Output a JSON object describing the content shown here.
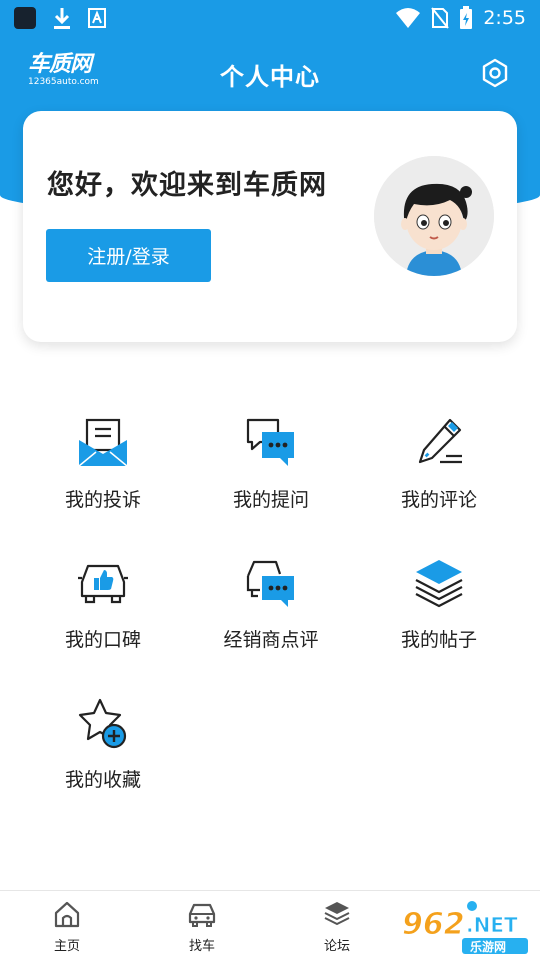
{
  "status_bar": {
    "time": "2:55"
  },
  "header": {
    "logo_main": "车质网",
    "logo_sub": "12365auto.com",
    "title": "个人中心"
  },
  "card": {
    "welcome": "您好，欢迎来到车质网",
    "login_label": "注册/登录"
  },
  "menu": {
    "complaints": "我的投诉",
    "questions": "我的提问",
    "reviews": "我的评论",
    "reputation": "我的口碑",
    "dealer_review": "经销商点评",
    "posts": "我的帖子",
    "favorites": "我的收藏"
  },
  "nav": {
    "home": "主页",
    "find_car": "找车",
    "forum": "论坛"
  },
  "watermark": {
    "text_main": "962",
    "text_net": ".NET",
    "text_sub": "乐游网"
  },
  "colors": {
    "brand": "#1a9be6",
    "accent_light": "#27b0f0"
  }
}
